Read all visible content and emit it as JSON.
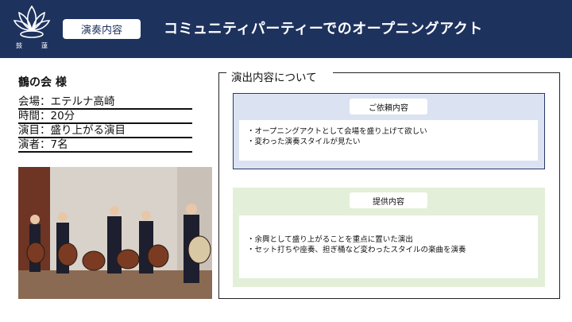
{
  "logo": {
    "char_left": "鼓",
    "char_right": "蓮"
  },
  "header": {
    "tag": "演奏内容",
    "title": "コミュニティパーティーでのオープニングアクト"
  },
  "client": "鶴の会 様",
  "info": [
    "会場：エテルナ高崎",
    "時間：20分",
    "演目：盛り上がる演目",
    "演者：7名"
  ],
  "panel": {
    "title": "演出内容について",
    "request": {
      "label": "ご依頼内容",
      "items": [
        "・オープニングアクトとして会場を盛り上げて欲しい",
        "・変わった演奏スタイルが見たい"
      ]
    },
    "offer": {
      "label": "提供内容",
      "items": [
        "・余興として盛り上がることを重点に置いた演出",
        "・セット打ちや座奏、担ぎ桶など変わったスタイルの楽曲を演奏"
      ]
    }
  },
  "colors": {
    "header_bg": "#1e325e",
    "request_bg": "#dbe3f2",
    "offer_bg": "#e4efd9"
  }
}
